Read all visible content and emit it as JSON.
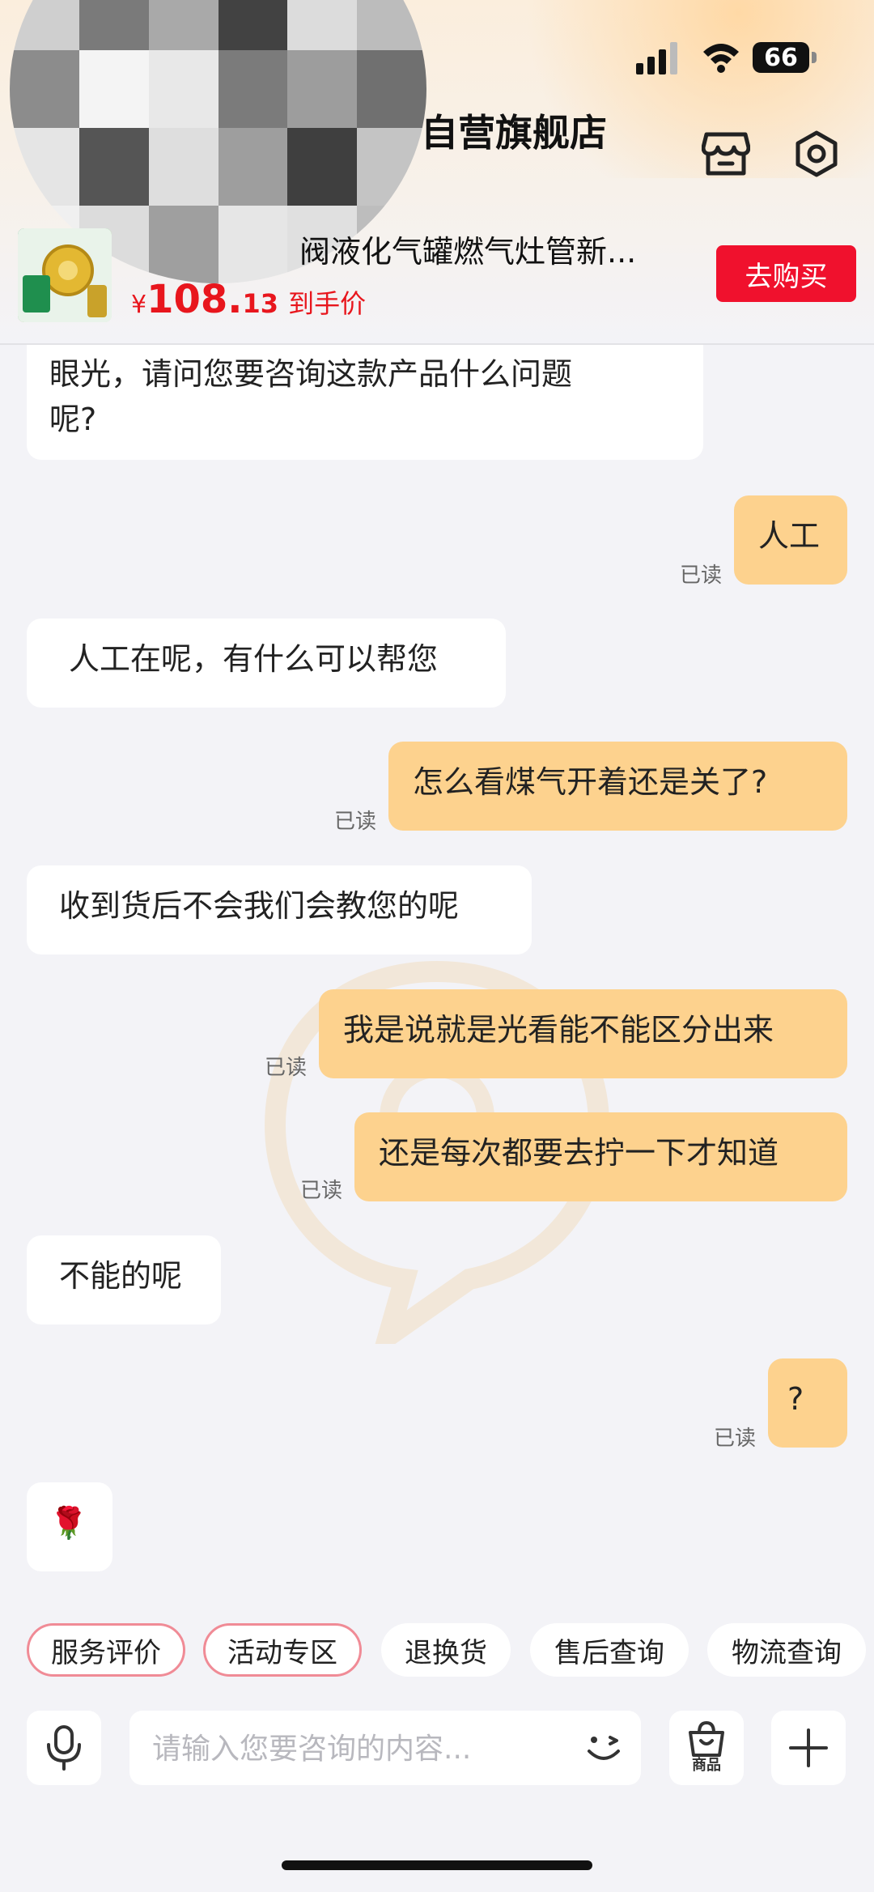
{
  "status_bar": {
    "time": "",
    "battery": "66"
  },
  "header": {
    "store_name": "自营旗舰店",
    "store_icon": "store-icon",
    "settings_icon": "settings-icon"
  },
  "product": {
    "title": "阀液化气罐燃气灶管新...",
    "price_symbol": "¥",
    "price_int": "108.",
    "price_dec": "13",
    "price_label": "到手价",
    "buy_label": "去购买"
  },
  "messages": [
    {
      "side": "left",
      "lines": [
        "眼光，请问您要咨询这款产品什么问题",
        "呢?"
      ]
    },
    {
      "side": "right",
      "text": "人工",
      "read": "已读"
    },
    {
      "side": "left",
      "text": "人工在呢，有什么可以帮您"
    },
    {
      "side": "right",
      "text": "怎么看煤气开着还是关了?",
      "read": "已读"
    },
    {
      "side": "left",
      "text": "收到货后不会我们会教您的呢"
    },
    {
      "side": "right",
      "text": "我是说就是光看能不能区分出来",
      "read": "已读"
    },
    {
      "side": "right",
      "text": "还是每次都要去拧一下才知道",
      "read": "已读"
    },
    {
      "side": "left",
      "text": "不能的呢"
    },
    {
      "side": "right",
      "text": "?",
      "read": "已读"
    },
    {
      "side": "left",
      "text": "🌹"
    }
  ],
  "quick_actions": [
    "服务评价",
    "活动专区",
    "退换货",
    "售后查询",
    "物流查询"
  ],
  "input": {
    "placeholder": "请输入您要咨询的内容...",
    "goods_label": "商品"
  },
  "colors": {
    "accent_red": "#f0112d",
    "price_red": "#e8161d",
    "bubble_user": "#fdd28e",
    "bubble_agent": "#ffffff",
    "background": "#f3f3f7"
  }
}
